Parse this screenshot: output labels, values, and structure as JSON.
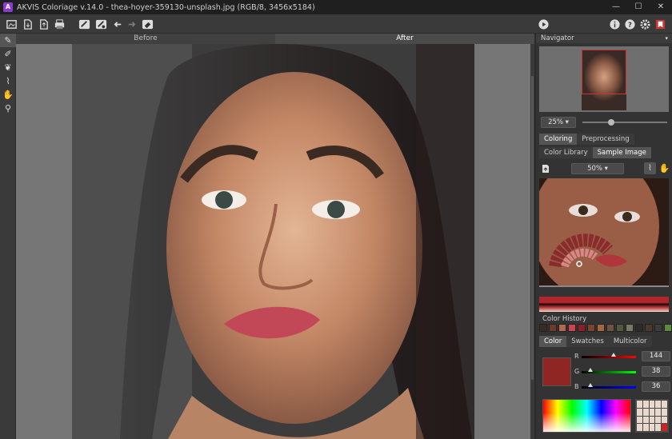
{
  "window": {
    "title": "AKVIS Coloriage v.14.0 - thea-hoyer-359130-unsplash.jpg (RGB/8, 3456x5184)",
    "app_icon_letter": "A",
    "minimize": "—",
    "maximize": "☐",
    "close": "✕"
  },
  "toolbar": {
    "icons": [
      "open-file-icon",
      "save-icon",
      "export-icon",
      "print-icon",
      "pencil-before-icon",
      "pencil-after-icon",
      "undo-icon",
      "redo-icon",
      "eraser-icon",
      "run-icon",
      "info-icon",
      "help-icon",
      "settings-icon",
      "bookmark-icon"
    ]
  },
  "view_tabs": {
    "before": "Before",
    "after": "After"
  },
  "navigator": {
    "header": "Navigator",
    "arrow": "▾",
    "zoom": "25%",
    "zoom_level": 0.3
  },
  "coloring_tabs": {
    "coloring": "Coloring",
    "preprocessing": "Preprocessing"
  },
  "library_tabs": {
    "color_library": "Color Library",
    "sample_image": "Sample Image"
  },
  "sample": {
    "zoom": "50%"
  },
  "color_history": {
    "label": "Color History",
    "colors": [
      "#3a2a24",
      "#6b3c2a",
      "#b06a4e",
      "#c9454f",
      "#8a1f2a",
      "#7a4430",
      "#a4653f",
      "#6e5440",
      "#4e5a3a",
      "#7a7a62",
      "#2e2a26",
      "#4a3a2e",
      "#3c3c3c",
      "#5a8a3a"
    ]
  },
  "color_tabs": {
    "color": "Color",
    "swatches": "Swatches",
    "multicolor": "Multicolor"
  },
  "rgb": {
    "r_label": "R",
    "g_label": "G",
    "b_label": "B",
    "r": "144",
    "g": "38",
    "b": "36",
    "preview_color": "#902624"
  }
}
